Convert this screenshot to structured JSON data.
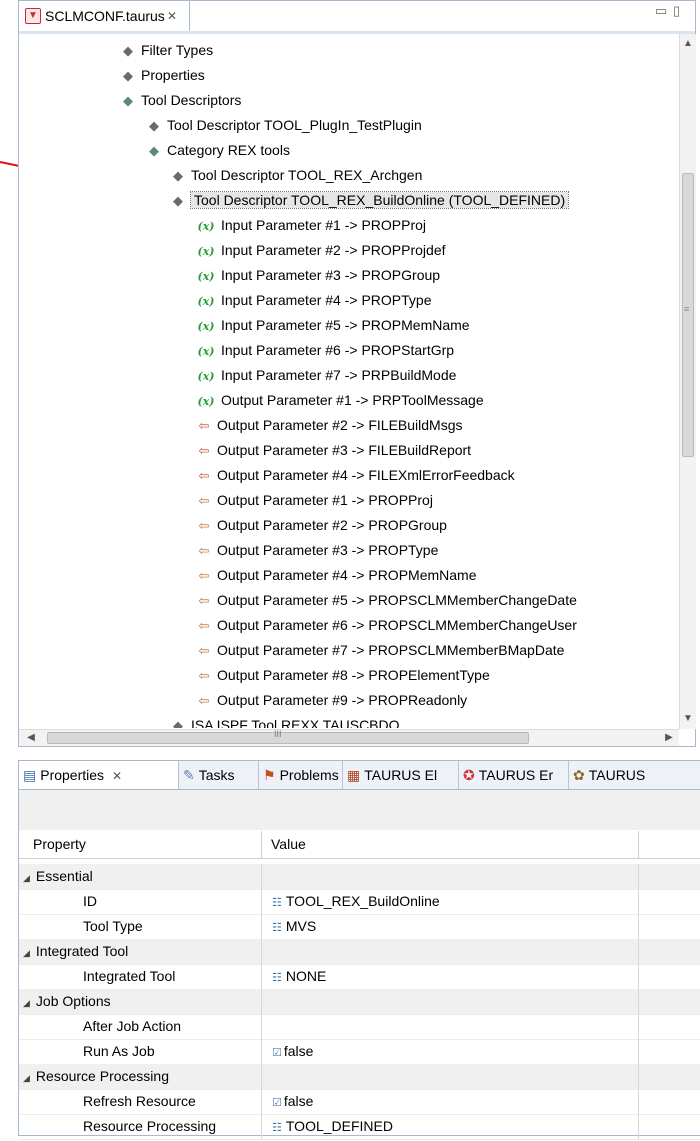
{
  "editor": {
    "tab_label": "SCLMCONF.taurus",
    "tab_close": "✕",
    "minimize": "▭",
    "maximize": "▯",
    "tree": [
      {
        "indent": 1,
        "icon": "diamond",
        "text": "Filter Types"
      },
      {
        "indent": 1,
        "icon": "diamond",
        "text": "Properties"
      },
      {
        "indent": 1,
        "icon": "diamond-teal",
        "text": "Tool Descriptors"
      },
      {
        "indent": 2,
        "icon": "diamond",
        "text": "Tool Descriptor TOOL_PlugIn_TestPlugin"
      },
      {
        "indent": 2,
        "icon": "diamond-teal",
        "text": "Category REX tools"
      },
      {
        "indent": 3,
        "icon": "diamond",
        "text": "Tool Descriptor TOOL_REX_Archgen"
      },
      {
        "indent": 3,
        "icon": "diamond",
        "text": "Tool Descriptor TOOL_REX_BuildOnline (TOOL_DEFINED)",
        "selected": true
      },
      {
        "indent": 4,
        "icon": "fx",
        "text": "Input Parameter #1 -> PROPProj"
      },
      {
        "indent": 4,
        "icon": "fx",
        "text": "Input Parameter #2 -> PROPProjdef"
      },
      {
        "indent": 4,
        "icon": "fx",
        "text": "Input Parameter #3 -> PROPGroup"
      },
      {
        "indent": 4,
        "icon": "fx",
        "text": "Input Parameter #4 -> PROPType"
      },
      {
        "indent": 4,
        "icon": "fx",
        "text": "Input Parameter #5 -> PROPMemName"
      },
      {
        "indent": 4,
        "icon": "fx",
        "text": "Input Parameter #6 -> PROPStartGrp"
      },
      {
        "indent": 4,
        "icon": "fx",
        "text": "Input Parameter #7 -> PRPBuildMode"
      },
      {
        "indent": 4,
        "icon": "fx",
        "text": "Output Parameter #1 -> PRPToolMessage"
      },
      {
        "indent": 4,
        "icon": "outfile",
        "text": "Output Parameter #2 -> FILEBuildMsgs"
      },
      {
        "indent": 4,
        "icon": "outfile",
        "text": "Output Parameter #3 -> FILEBuildReport"
      },
      {
        "indent": 4,
        "icon": "outfile",
        "text": "Output Parameter #4 -> FILEXmlErrorFeedback"
      },
      {
        "indent": 4,
        "icon": "outprop",
        "text": "Output Parameter #1 -> PROPProj"
      },
      {
        "indent": 4,
        "icon": "outprop",
        "text": "Output Parameter #2 -> PROPGroup"
      },
      {
        "indent": 4,
        "icon": "outprop",
        "text": "Output Parameter #3 -> PROPType"
      },
      {
        "indent": 4,
        "icon": "outprop",
        "text": "Output Parameter #4 -> PROPMemName"
      },
      {
        "indent": 4,
        "icon": "outprop",
        "text": "Output Parameter #5 -> PROPSCLMMemberChangeDate"
      },
      {
        "indent": 4,
        "icon": "outprop",
        "text": "Output Parameter #6 -> PROPSCLMMemberChangeUser"
      },
      {
        "indent": 4,
        "icon": "outprop",
        "text": "Output Parameter #7 -> PROPSCLMMemberBMapDate"
      },
      {
        "indent": 4,
        "icon": "outprop",
        "text": "Output Parameter #8 -> PROPElementType"
      },
      {
        "indent": 4,
        "icon": "outprop",
        "text": "Output Parameter #9 -> PROPReadonly"
      },
      {
        "indent": 3,
        "icon": "diamond",
        "text": "ISA ISPF Tool REXX TAUSCBDO"
      }
    ],
    "hscroll_grip": "III"
  },
  "properties": {
    "tabs": [
      {
        "label": "Properties",
        "suffix": "✕",
        "icon": "properties-icon"
      },
      {
        "label": "Tasks",
        "icon": "tasks-icon"
      },
      {
        "label": "Problems",
        "icon": "problems-icon"
      },
      {
        "label": "TAURUS El",
        "icon": "taurus-el-icon"
      },
      {
        "label": "TAURUS Er",
        "icon": "taurus-er-icon"
      },
      {
        "label": "TAURUS",
        "icon": "taurus-icon"
      }
    ],
    "col_property": "Property",
    "col_value": "Value",
    "rows": [
      {
        "cat": true,
        "label": "Essential"
      },
      {
        "label": "ID",
        "value": "TOOL_REX_BuildOnline",
        "vtype": "list"
      },
      {
        "label": "Tool Type",
        "value": "MVS",
        "vtype": "list"
      },
      {
        "cat": true,
        "label": "Integrated Tool"
      },
      {
        "label": "Integrated Tool",
        "value": "NONE",
        "vtype": "list"
      },
      {
        "cat": true,
        "label": "Job Options"
      },
      {
        "label": "After Job Action",
        "value": "",
        "vtype": ""
      },
      {
        "label": "Run As Job",
        "value": "false",
        "vtype": "bool"
      },
      {
        "cat": true,
        "label": "Resource Processing"
      },
      {
        "label": "Refresh Resource",
        "value": "false",
        "vtype": "bool"
      },
      {
        "label": "Resource Processing",
        "value": "TOOL_DEFINED",
        "vtype": "list"
      }
    ]
  },
  "colors": {
    "annotation_arrow": "#e01010",
    "selection": "#e6e6e6",
    "accent": "#a9b8cc"
  }
}
